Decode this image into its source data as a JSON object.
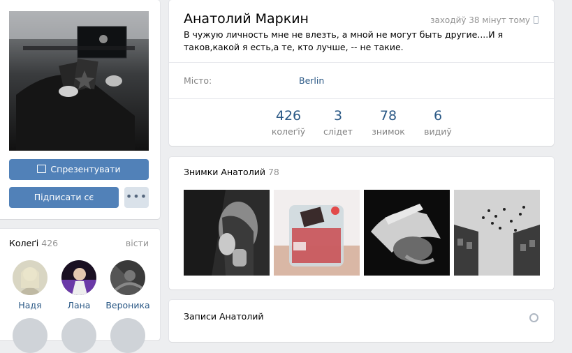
{
  "profile": {
    "name": "Анатолий Маркин",
    "last_seen": "заходйў 38 мінут тому",
    "bio": "В чужую личность мне не влезть, а мной не могут быть другие....И я таков,какой я есть,а те, кто лучше, -- не такие.",
    "city_label": "Місто:",
    "city_value": "Berlin"
  },
  "counters": [
    {
      "num": "426",
      "label": "колеґіў"
    },
    {
      "num": "3",
      "label": "слідет"
    },
    {
      "num": "78",
      "label": "знимок"
    },
    {
      "num": "6",
      "label": "видиў"
    }
  ],
  "buttons": {
    "present": "Спрезентувати",
    "subscribe": "Підписати сє",
    "more": "•••"
  },
  "friends": {
    "title": "Колеґі",
    "count": "426",
    "all": "вісти",
    "items": [
      {
        "name": "Надя"
      },
      {
        "name": "Лана"
      },
      {
        "name": "Вероника"
      }
    ]
  },
  "photos": {
    "title": "Знимки Анатолий",
    "count": "78"
  },
  "posts": {
    "title": "Записи Анатолий"
  },
  "colors": {
    "accent": "#5181b8",
    "link": "#2a5885",
    "page_bg": "#edeef0"
  },
  "icons": {
    "gift": "gift-icon",
    "more": "more-dots-icon",
    "phone": "mobile-phone-icon",
    "search": "search-icon"
  }
}
